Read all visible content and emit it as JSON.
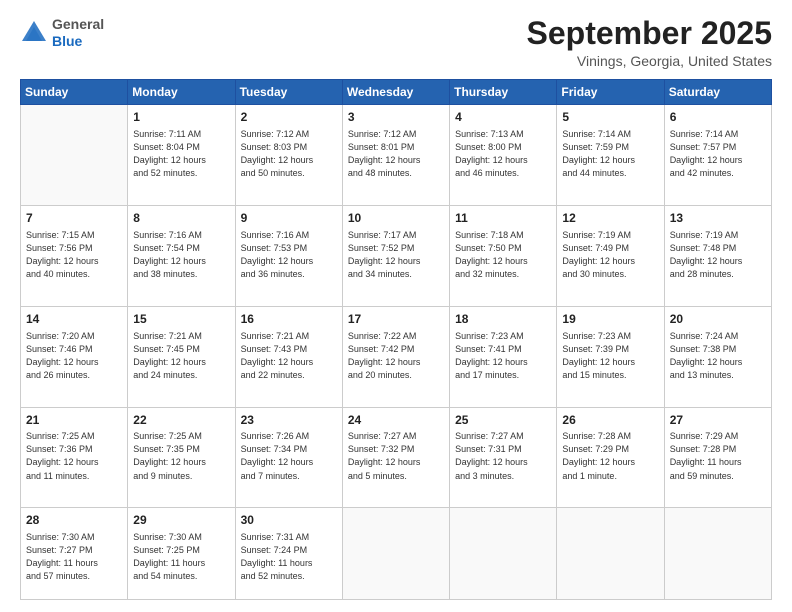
{
  "header": {
    "logo_general": "General",
    "logo_blue": "Blue",
    "month": "September 2025",
    "location": "Vinings, Georgia, United States"
  },
  "days_of_week": [
    "Sunday",
    "Monday",
    "Tuesday",
    "Wednesday",
    "Thursday",
    "Friday",
    "Saturday"
  ],
  "weeks": [
    [
      {
        "day": "",
        "info": ""
      },
      {
        "day": "1",
        "info": "Sunrise: 7:11 AM\nSunset: 8:04 PM\nDaylight: 12 hours\nand 52 minutes."
      },
      {
        "day": "2",
        "info": "Sunrise: 7:12 AM\nSunset: 8:03 PM\nDaylight: 12 hours\nand 50 minutes."
      },
      {
        "day": "3",
        "info": "Sunrise: 7:12 AM\nSunset: 8:01 PM\nDaylight: 12 hours\nand 48 minutes."
      },
      {
        "day": "4",
        "info": "Sunrise: 7:13 AM\nSunset: 8:00 PM\nDaylight: 12 hours\nand 46 minutes."
      },
      {
        "day": "5",
        "info": "Sunrise: 7:14 AM\nSunset: 7:59 PM\nDaylight: 12 hours\nand 44 minutes."
      },
      {
        "day": "6",
        "info": "Sunrise: 7:14 AM\nSunset: 7:57 PM\nDaylight: 12 hours\nand 42 minutes."
      }
    ],
    [
      {
        "day": "7",
        "info": "Sunrise: 7:15 AM\nSunset: 7:56 PM\nDaylight: 12 hours\nand 40 minutes."
      },
      {
        "day": "8",
        "info": "Sunrise: 7:16 AM\nSunset: 7:54 PM\nDaylight: 12 hours\nand 38 minutes."
      },
      {
        "day": "9",
        "info": "Sunrise: 7:16 AM\nSunset: 7:53 PM\nDaylight: 12 hours\nand 36 minutes."
      },
      {
        "day": "10",
        "info": "Sunrise: 7:17 AM\nSunset: 7:52 PM\nDaylight: 12 hours\nand 34 minutes."
      },
      {
        "day": "11",
        "info": "Sunrise: 7:18 AM\nSunset: 7:50 PM\nDaylight: 12 hours\nand 32 minutes."
      },
      {
        "day": "12",
        "info": "Sunrise: 7:19 AM\nSunset: 7:49 PM\nDaylight: 12 hours\nand 30 minutes."
      },
      {
        "day": "13",
        "info": "Sunrise: 7:19 AM\nSunset: 7:48 PM\nDaylight: 12 hours\nand 28 minutes."
      }
    ],
    [
      {
        "day": "14",
        "info": "Sunrise: 7:20 AM\nSunset: 7:46 PM\nDaylight: 12 hours\nand 26 minutes."
      },
      {
        "day": "15",
        "info": "Sunrise: 7:21 AM\nSunset: 7:45 PM\nDaylight: 12 hours\nand 24 minutes."
      },
      {
        "day": "16",
        "info": "Sunrise: 7:21 AM\nSunset: 7:43 PM\nDaylight: 12 hours\nand 22 minutes."
      },
      {
        "day": "17",
        "info": "Sunrise: 7:22 AM\nSunset: 7:42 PM\nDaylight: 12 hours\nand 20 minutes."
      },
      {
        "day": "18",
        "info": "Sunrise: 7:23 AM\nSunset: 7:41 PM\nDaylight: 12 hours\nand 17 minutes."
      },
      {
        "day": "19",
        "info": "Sunrise: 7:23 AM\nSunset: 7:39 PM\nDaylight: 12 hours\nand 15 minutes."
      },
      {
        "day": "20",
        "info": "Sunrise: 7:24 AM\nSunset: 7:38 PM\nDaylight: 12 hours\nand 13 minutes."
      }
    ],
    [
      {
        "day": "21",
        "info": "Sunrise: 7:25 AM\nSunset: 7:36 PM\nDaylight: 12 hours\nand 11 minutes."
      },
      {
        "day": "22",
        "info": "Sunrise: 7:25 AM\nSunset: 7:35 PM\nDaylight: 12 hours\nand 9 minutes."
      },
      {
        "day": "23",
        "info": "Sunrise: 7:26 AM\nSunset: 7:34 PM\nDaylight: 12 hours\nand 7 minutes."
      },
      {
        "day": "24",
        "info": "Sunrise: 7:27 AM\nSunset: 7:32 PM\nDaylight: 12 hours\nand 5 minutes."
      },
      {
        "day": "25",
        "info": "Sunrise: 7:27 AM\nSunset: 7:31 PM\nDaylight: 12 hours\nand 3 minutes."
      },
      {
        "day": "26",
        "info": "Sunrise: 7:28 AM\nSunset: 7:29 PM\nDaylight: 12 hours\nand 1 minute."
      },
      {
        "day": "27",
        "info": "Sunrise: 7:29 AM\nSunset: 7:28 PM\nDaylight: 11 hours\nand 59 minutes."
      }
    ],
    [
      {
        "day": "28",
        "info": "Sunrise: 7:30 AM\nSunset: 7:27 PM\nDaylight: 11 hours\nand 57 minutes."
      },
      {
        "day": "29",
        "info": "Sunrise: 7:30 AM\nSunset: 7:25 PM\nDaylight: 11 hours\nand 54 minutes."
      },
      {
        "day": "30",
        "info": "Sunrise: 7:31 AM\nSunset: 7:24 PM\nDaylight: 11 hours\nand 52 minutes."
      },
      {
        "day": "",
        "info": ""
      },
      {
        "day": "",
        "info": ""
      },
      {
        "day": "",
        "info": ""
      },
      {
        "day": "",
        "info": ""
      }
    ]
  ]
}
